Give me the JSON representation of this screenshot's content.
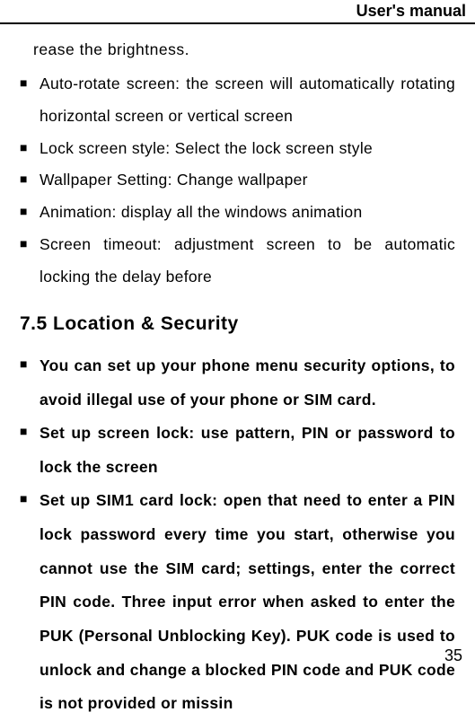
{
  "header": {
    "title": "User's manual"
  },
  "fragment_top": "rease  the  brightness.",
  "list_a": {
    "items": [
      "Auto-rotate  screen:  the  screen will  automatically rotating horizontal  screen or vertical screen",
      "Lock  screen  style:  Select  the  lock  screen  style",
      "Wallpaper  Setting:  Change  wallpaper",
      "Animation: display all  the  windows animation",
      "Screen  timeout:  adjustment  screen  to  be  automatic  locking  the  delay  before"
    ]
  },
  "section_heading": "7.5  Location  &  Security",
  "list_b": {
    "items": [
      "You  can  set  up  your  phone  menu  security  options,  to  avoid  illegal  use  of  your  phone  or  SIM  card.",
      "Set  up  screen  lock:  use  pattern,  PIN  or  password  to  lock  the  screen",
      "Set  up  SIM1  card lock:  open that need  to  enter a PIN lock  password every  time  you  start, otherwise you  cannot  use the SIM  card; settings, enter  the  correct  PIN  code. Three input  error when asked  to  enter the PUK  (Personal  Unblocking  Key). PUK  code is  used  to unlock and change  a  blocked PIN  code and PUK  code is  not  provided or missin"
    ]
  },
  "page_number": "35"
}
